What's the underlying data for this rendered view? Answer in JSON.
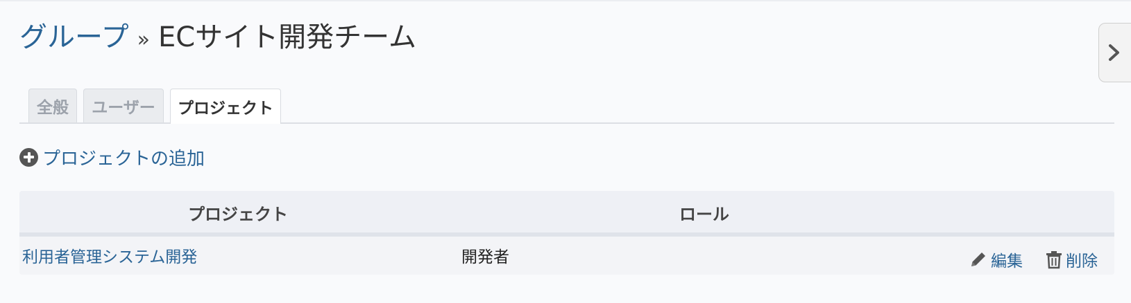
{
  "breadcrumb": {
    "parent_label": "グループ",
    "separator": "»",
    "current_label": "ECサイト開発チーム"
  },
  "tabs": [
    {
      "label": "全般",
      "active": false
    },
    {
      "label": "ユーザー",
      "active": false
    },
    {
      "label": "プロジェクト",
      "active": true
    }
  ],
  "add_project": {
    "label": "プロジェクトの追加",
    "icon": "plus-circle-icon"
  },
  "table": {
    "headers": [
      "プロジェクト",
      "ロール"
    ],
    "rows": [
      {
        "project": "利用者管理システム開発",
        "role": "開発者",
        "actions": [
          {
            "label": "編集",
            "icon": "pencil-icon"
          },
          {
            "label": "削除",
            "icon": "trash-icon"
          }
        ]
      }
    ]
  },
  "sidebar_toggle": {
    "icon": "chevron-right-icon"
  },
  "colors": {
    "link": "#2a6496",
    "background": "#f9fafc",
    "header_bg": "#eef0f5"
  }
}
